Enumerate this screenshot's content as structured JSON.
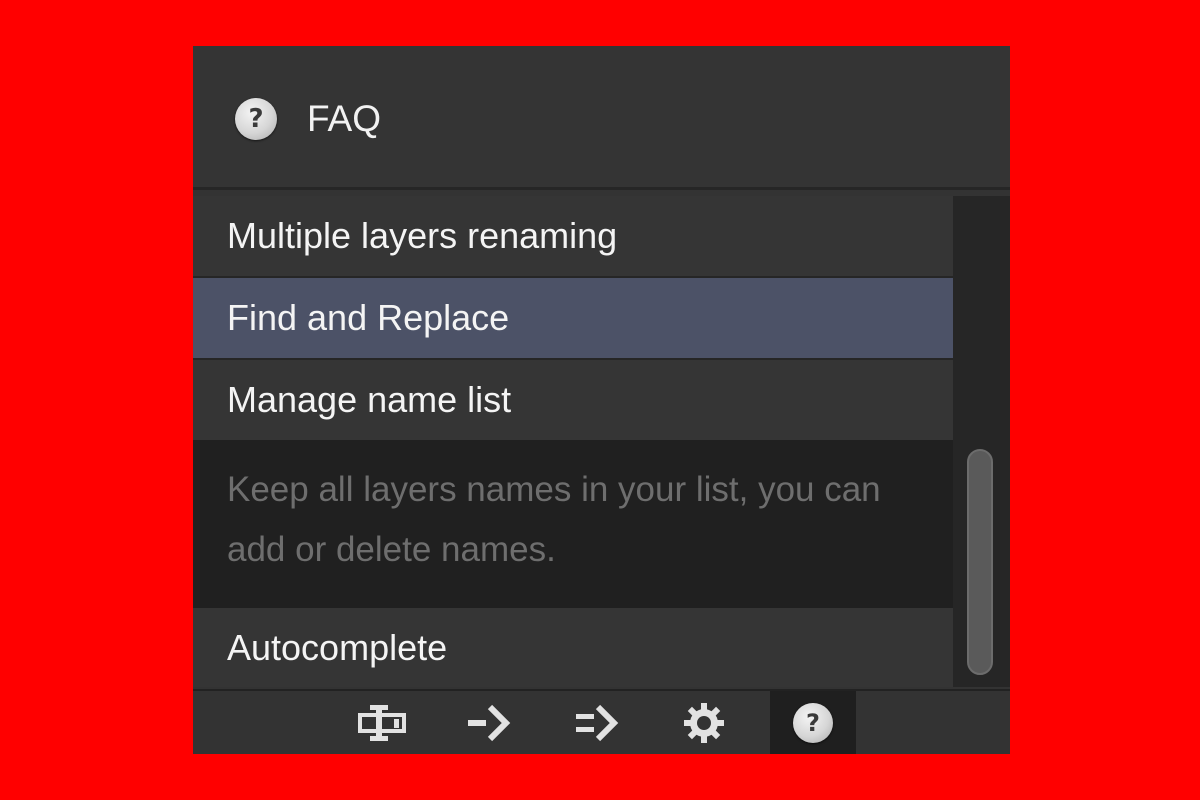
{
  "header": {
    "title": "FAQ",
    "icon": "help-icon",
    "icon_glyph": "?"
  },
  "faq": {
    "items": [
      {
        "label": "Multiple layers renaming",
        "selected": false
      },
      {
        "label": "Find and Replace",
        "selected": true
      },
      {
        "label": "Manage name list",
        "selected": false,
        "expanded": true,
        "description": "Keep all layers names in your list, you can add or delete names."
      },
      {
        "label": "Autocomplete",
        "selected": false
      }
    ]
  },
  "toolbar": {
    "buttons": [
      {
        "name": "rename-icon",
        "active": false
      },
      {
        "name": "arrow-right-icon",
        "active": false
      },
      {
        "name": "multi-arrow-right-icon",
        "active": false
      },
      {
        "name": "gear-icon",
        "active": false
      },
      {
        "name": "help-icon",
        "active": true,
        "glyph": "?"
      }
    ]
  },
  "colors": {
    "background": "#ff0000",
    "panel": "#333333",
    "selected": "#4c5267",
    "description_bg": "#202020",
    "description_text": "#6e6e6e",
    "text": "#f4f4f4"
  }
}
